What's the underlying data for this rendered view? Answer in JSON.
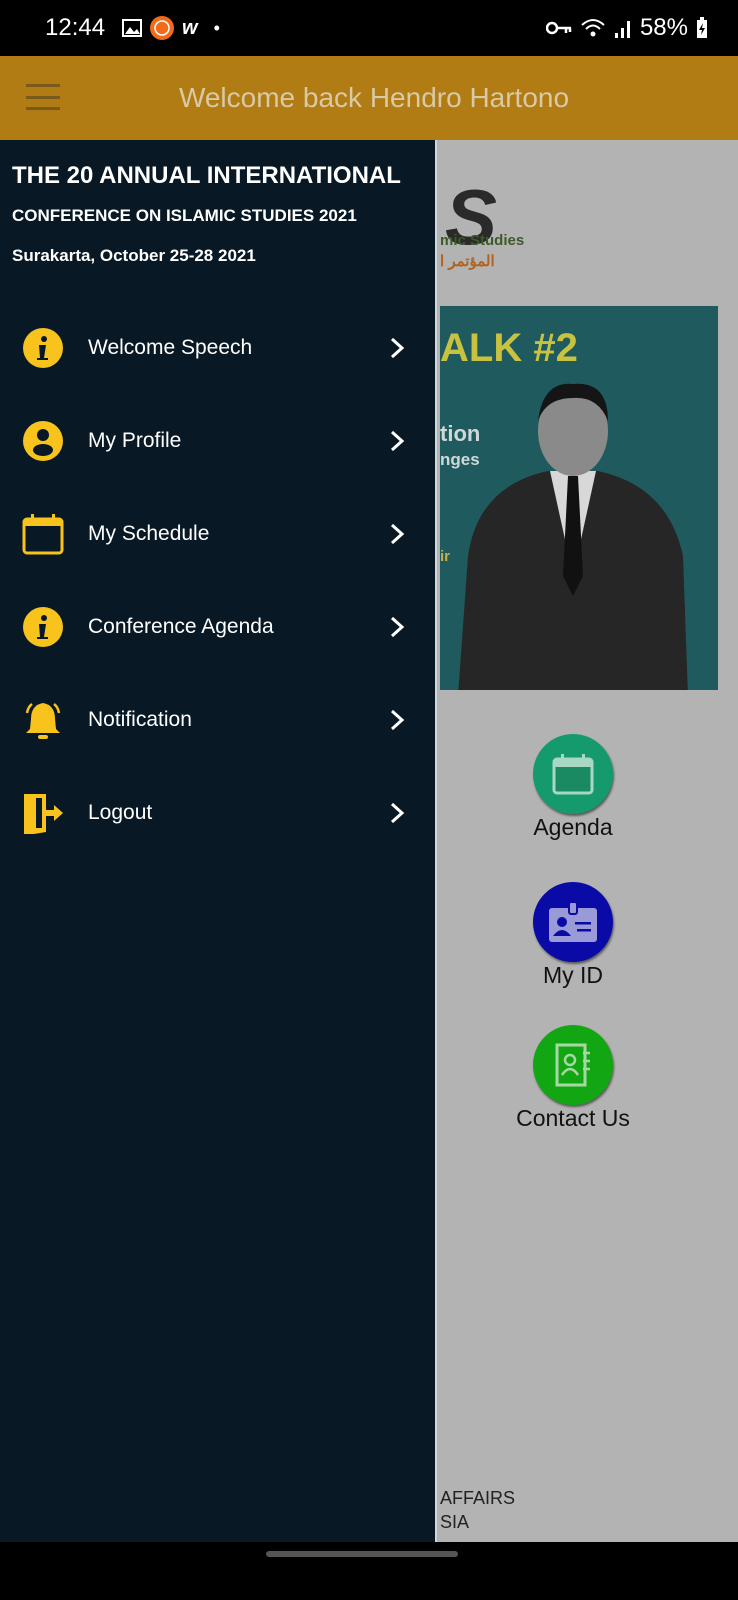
{
  "status_bar": {
    "time": "12:44",
    "battery": "58%",
    "icons": [
      "gallery-icon",
      "mi-app-icon",
      "w-app-icon",
      "dot-icon",
      "key-icon",
      "wifi-icon",
      "signal-icon",
      "battery-icon"
    ]
  },
  "app_bar": {
    "title": "Welcome back Hendro Hartono",
    "color": "#b07c13"
  },
  "background": {
    "logo_text": [
      "S",
      "mic Studies",
      "المؤتمر ا"
    ],
    "banner_text": [
      "ALK #2",
      "tion",
      "nges",
      "ir"
    ],
    "tiles": [
      {
        "label": "Agenda",
        "color": "#159a6e",
        "icon": "calendar-icon"
      },
      {
        "label": "My ID",
        "color": "#0a0aa6",
        "icon": "id-card-icon"
      },
      {
        "label": "Contact Us",
        "color": "#12a612",
        "icon": "contact-book-icon"
      }
    ],
    "footer": [
      "AFFAIRS",
      "SIA"
    ]
  },
  "drawer": {
    "title": "THE 20 ANNUAL INTERNATIONAL",
    "subtitle": "CONFERENCE ON ISLAMIC STUDIES 2021",
    "date": "Surakarta, October 25-28 2021",
    "accent": "#f7c31c",
    "items": [
      {
        "label": "Welcome Speech",
        "icon": "info-icon"
      },
      {
        "label": "My Profile",
        "icon": "user-icon"
      },
      {
        "label": "My Schedule",
        "icon": "calendar-icon"
      },
      {
        "label": "Conference Agenda",
        "icon": "info-icon"
      },
      {
        "label": "Notification",
        "icon": "bell-icon"
      },
      {
        "label": "Logout",
        "icon": "logout-icon"
      }
    ]
  }
}
